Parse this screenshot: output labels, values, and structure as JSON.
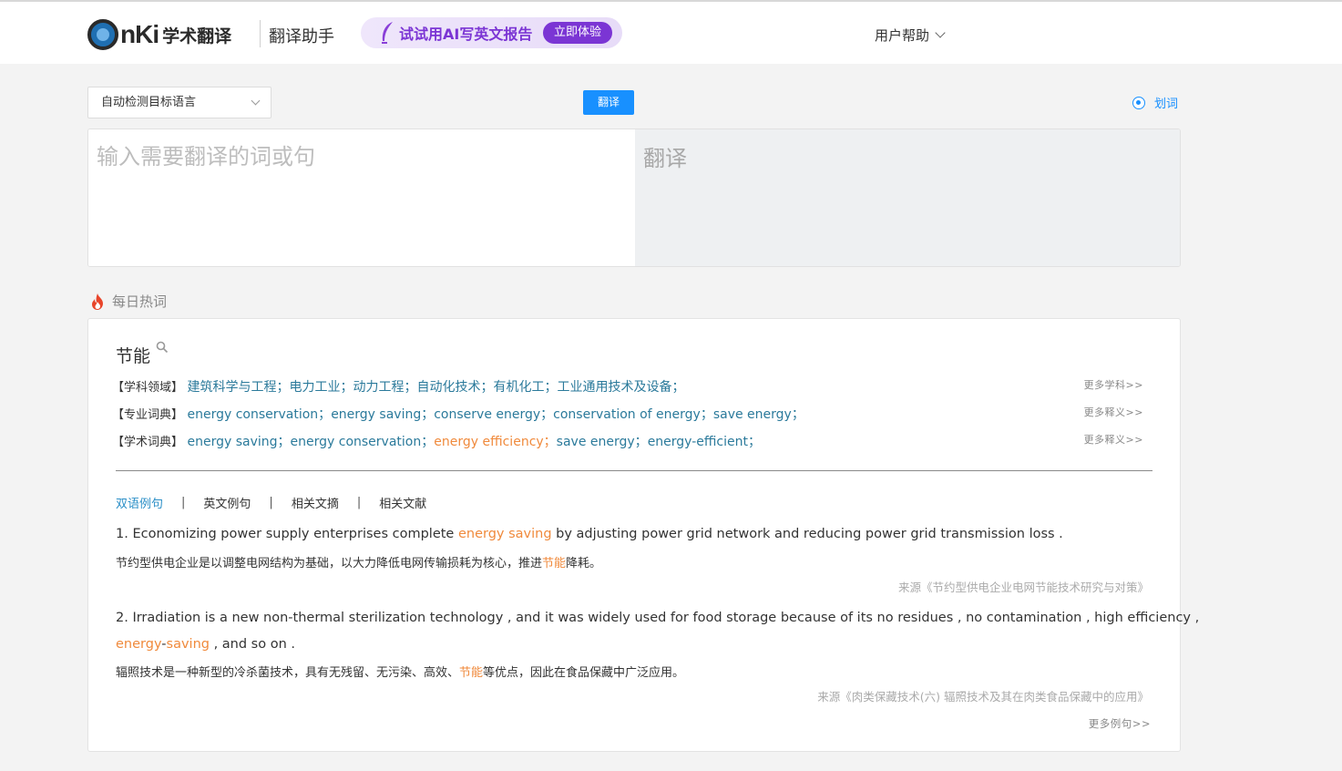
{
  "header": {
    "logo_text": "nKi",
    "logo_sub": "学术翻译",
    "assistant": "翻译助手",
    "promo_text": "试试用AI写英文报告",
    "promo_button": "立即体验",
    "help": "用户帮助"
  },
  "controls": {
    "lang_select": "自动检测目标语言",
    "translate_button": "翻译",
    "huaci": "划词"
  },
  "panes": {
    "input_placeholder": "输入需要翻译的词或句",
    "output_placeholder": "翻译"
  },
  "hot": {
    "title": "每日热词",
    "word": "节能",
    "rows": [
      {
        "tag": "【学科领域】",
        "items": [
          "建筑科学与工程；",
          "电力工业；",
          "动力工程；",
          "自动化技术；",
          "有机化工；",
          "工业通用技术及设备；"
        ],
        "more": "更多学科>>"
      },
      {
        "tag": "【专业词典】",
        "items": [
          "energy conservation；",
          "energy saving；",
          "conserve energy；",
          "conservation of energy；",
          "save energy；"
        ],
        "more": "更多释义>>"
      },
      {
        "tag": "【学术词典】",
        "items": [
          "energy saving；",
          "energy conservation；",
          "energy efficiency；",
          "save energy；",
          "energy-efficient；"
        ],
        "highlight_index": 2,
        "more": "更多释义>>"
      }
    ],
    "tabs": [
      "双语例句",
      "英文例句",
      "相关文摘",
      "相关文献"
    ],
    "examples": [
      {
        "en_before": "1. Economizing power supply enterprises complete ",
        "en_hl": "energy saving",
        "en_after": " by adjusting power grid network and reducing power grid transmission loss .",
        "cn_before": "节约型供电企业是以调整电网结构为基础，以大力降低电网传输损耗为核心，推进",
        "cn_hl": "节能",
        "cn_after": "降耗。",
        "source": "来源《节约型供电企业电网节能技术研究与对策》"
      },
      {
        "en_line1": "2. Irradiation is a new non-thermal sterilization technology , and it was widely used for food storage because of its no residues , no contamination , high efficiency ,",
        "en_hl_a": "energy",
        "en_dash": "-",
        "en_hl_b": "saving",
        "en_after": " , and so on .",
        "cn_before": "辐照技术是一种新型的冷杀菌技术，具有无残留、无污染、高效、",
        "cn_hl": "节能",
        "cn_after": "等优点，因此在食品保藏中广泛应用。",
        "source": "来源《肉类保藏技术(六) 辐照技术及其在肉类食品保藏中的应用》"
      }
    ],
    "more_examples": "更多例句>>"
  }
}
